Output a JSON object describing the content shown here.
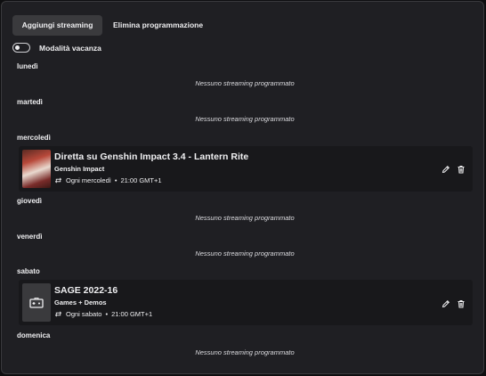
{
  "tabs": {
    "add_streaming": "Aggiungi streaming",
    "delete_schedule": "Elimina programmazione"
  },
  "vacation": {
    "label": "Modalità vacanza",
    "enabled": false
  },
  "days": [
    {
      "label": "lunedì",
      "empty_message": "Nessuno streaming programmato"
    },
    {
      "label": "martedì",
      "empty_message": "Nessuno streaming programmato"
    },
    {
      "label": "mercoledì",
      "stream": {
        "title": "Diretta su Genshin Impact 3.4 - Lantern Rite",
        "category": "Genshin Impact",
        "recurrence": "Ogni mercoledì",
        "separator": "•",
        "time": "21:00 GMT+1",
        "thumbnail": "genshin-cover"
      }
    },
    {
      "label": "giovedì",
      "empty_message": "Nessuno streaming programmato"
    },
    {
      "label": "venerdì",
      "empty_message": "Nessuno streaming programmato"
    },
    {
      "label": "sabato",
      "stream": {
        "title": "SAGE 2022-16",
        "category": "Games + Demos",
        "recurrence": "Ogni sabato",
        "separator": "•",
        "time": "21:00 GMT+1",
        "thumbnail": "default-controller"
      }
    },
    {
      "label": "domenica",
      "empty_message": "Nessuno streaming programmato"
    }
  ],
  "icons": {
    "repeat": "repeat-icon",
    "edit": "pencil-icon",
    "delete": "trash-icon",
    "controller": "gamepad-icon"
  },
  "colors": {
    "background": "#1f1f23",
    "card": "#18181b",
    "active_tab": "#3a3a3d",
    "text": "#efeff1"
  }
}
